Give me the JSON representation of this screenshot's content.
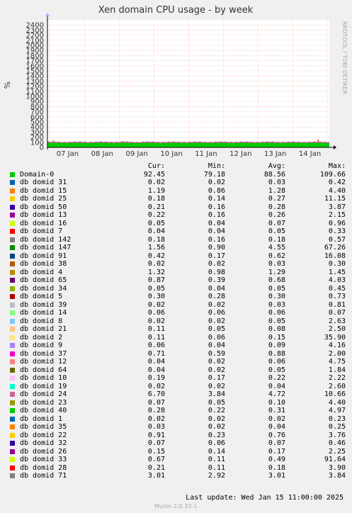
{
  "watermark": "RRDTOOL / TOBI OETIKER",
  "footer": {
    "last_update": "Last update:  Wed Jan 15 11:00:00 2025",
    "munin": "Munin 2.0.33-1"
  },
  "legend_header": {
    "cur": "Cur:",
    "min": "Min:",
    "avg": "Avg:",
    "max": "Max:"
  },
  "chart_data": {
    "type": "area",
    "title": "Xen domain CPU usage - by week",
    "ylabel": "%",
    "ylim": [
      0,
      2500
    ],
    "yticks": [
      0,
      100,
      200,
      300,
      400,
      500,
      600,
      700,
      800,
      900,
      1000,
      1100,
      1200,
      1300,
      1400,
      1500,
      1600,
      1700,
      1800,
      1900,
      2000,
      2100,
      2200,
      2300,
      2400
    ],
    "x_labels": [
      "07 Jan",
      "08 Jan",
      "09 Jan",
      "10 Jan",
      "11 Jan",
      "12 Jan",
      "13 Jan",
      "14 Jan"
    ],
    "grid": true,
    "series": [
      {
        "name": "Domain-0",
        "color": "#00cc00",
        "cur": "92.45",
        "min": "79.18",
        "avg": "88.56",
        "max": "109.66"
      },
      {
        "name": "db domid 31",
        "color": "#0066b3",
        "cur": "0.02",
        "min": "0.02",
        "avg": "0.03",
        "max": "0.42"
      },
      {
        "name": "db domid 15",
        "color": "#ff8000",
        "cur": "1.19",
        "min": "0.86",
        "avg": "1.28",
        "max": "4.40"
      },
      {
        "name": "db domid 25",
        "color": "#ffcc00",
        "cur": "0.18",
        "min": "0.14",
        "avg": "0.27",
        "max": "11.15"
      },
      {
        "name": "db domid 50",
        "color": "#330099",
        "cur": "0.21",
        "min": "0.16",
        "avg": "0.28",
        "max": "3.87"
      },
      {
        "name": "db domid 13",
        "color": "#990099",
        "cur": "0.22",
        "min": "0.16",
        "avg": "0.26",
        "max": "2.15"
      },
      {
        "name": "db domid 16",
        "color": "#ccff00",
        "cur": "0.05",
        "min": "0.04",
        "avg": "0.07",
        "max": "0.96"
      },
      {
        "name": "db domid 7",
        "color": "#ff0000",
        "cur": "0.04",
        "min": "0.04",
        "avg": "0.05",
        "max": "0.33"
      },
      {
        "name": "db domid 142",
        "color": "#808080",
        "cur": "0.18",
        "min": "0.16",
        "avg": "0.18",
        "max": "0.57"
      },
      {
        "name": "db domid 147",
        "color": "#008f00",
        "cur": "1.56",
        "min": "0.90",
        "avg": "4.55",
        "max": "67.26"
      },
      {
        "name": "db domid 91",
        "color": "#00487d",
        "cur": "0.42",
        "min": "0.17",
        "avg": "0.62",
        "max": "16.08"
      },
      {
        "name": "db domid 38",
        "color": "#b35a00",
        "cur": "0.02",
        "min": "0.02",
        "avg": "0.03",
        "max": "0.30"
      },
      {
        "name": "db domid 4",
        "color": "#b38f00",
        "cur": "1.32",
        "min": "0.98",
        "avg": "1.29",
        "max": "1.45"
      },
      {
        "name": "db domid 65",
        "color": "#6b006b",
        "cur": "0.87",
        "min": "0.39",
        "avg": "0.68",
        "max": "4.03"
      },
      {
        "name": "db domid 34",
        "color": "#8fb300",
        "cur": "0.05",
        "min": "0.04",
        "avg": "0.05",
        "max": "0.45"
      },
      {
        "name": "db domid 5",
        "color": "#b30000",
        "cur": "0.30",
        "min": "0.28",
        "avg": "0.30",
        "max": "0.73"
      },
      {
        "name": "db domid 39",
        "color": "#bebebe",
        "cur": "0.02",
        "min": "0.02",
        "avg": "0.03",
        "max": "0.81"
      },
      {
        "name": "db domid 14",
        "color": "#80ff80",
        "cur": "0.06",
        "min": "0.06",
        "avg": "0.06",
        "max": "0.07"
      },
      {
        "name": "db domid 8",
        "color": "#80c9ff",
        "cur": "0.02",
        "min": "0.02",
        "avg": "0.05",
        "max": "2.63"
      },
      {
        "name": "db domid 21",
        "color": "#ffc080",
        "cur": "0.11",
        "min": "0.05",
        "avg": "0.08",
        "max": "2.50"
      },
      {
        "name": "db domid 2",
        "color": "#ffe680",
        "cur": "0.11",
        "min": "0.06",
        "avg": "0.15",
        "max": "35.90"
      },
      {
        "name": "db domid 9",
        "color": "#aa80ff",
        "cur": "0.06",
        "min": "0.04",
        "avg": "0.09",
        "max": "4.16"
      },
      {
        "name": "db domid 37",
        "color": "#ee00cc",
        "cur": "0.71",
        "min": "0.59",
        "avg": "0.88",
        "max": "2.00"
      },
      {
        "name": "db domid 12",
        "color": "#ff8080",
        "cur": "0.04",
        "min": "0.02",
        "avg": "0.06",
        "max": "4.75"
      },
      {
        "name": "db domid 64",
        "color": "#666600",
        "cur": "0.04",
        "min": "0.02",
        "avg": "0.05",
        "max": "1.84"
      },
      {
        "name": "db domid 10",
        "color": "#ffbfff",
        "cur": "0.19",
        "min": "0.17",
        "avg": "0.22",
        "max": "2.22"
      },
      {
        "name": "db domid 19",
        "color": "#00ffcc",
        "cur": "0.02",
        "min": "0.02",
        "avg": "0.04",
        "max": "2.60"
      },
      {
        "name": "db domid 24",
        "color": "#cc6699",
        "cur": "6.70",
        "min": "3.84",
        "avg": "4.72",
        "max": "10.66"
      },
      {
        "name": "db domid 23",
        "color": "#999900",
        "cur": "0.07",
        "min": "0.05",
        "avg": "0.10",
        "max": "4.40"
      },
      {
        "name": "db domid 40",
        "color": "#00cc00",
        "cur": "0.28",
        "min": "0.22",
        "avg": "0.31",
        "max": "4.97"
      },
      {
        "name": "db domid 1",
        "color": "#0066b3",
        "cur": "0.02",
        "min": "0.02",
        "avg": "0.02",
        "max": "0.23"
      },
      {
        "name": "db domid 35",
        "color": "#ff8000",
        "cur": "0.03",
        "min": "0.02",
        "avg": "0.04",
        "max": "0.25"
      },
      {
        "name": "db domid 22",
        "color": "#ffcc00",
        "cur": "0.91",
        "min": "0.23",
        "avg": "0.76",
        "max": "3.76"
      },
      {
        "name": "db domid 32",
        "color": "#330099",
        "cur": "0.07",
        "min": "0.06",
        "avg": "0.07",
        "max": "0.46"
      },
      {
        "name": "db domid 26",
        "color": "#990099",
        "cur": "0.15",
        "min": "0.14",
        "avg": "0.17",
        "max": "2.25"
      },
      {
        "name": "db domid 33",
        "color": "#ccff00",
        "cur": "0.67",
        "min": "0.11",
        "avg": "0.49",
        "max": "91.64"
      },
      {
        "name": "db domid 28",
        "color": "#ff0000",
        "cur": "0.21",
        "min": "0.11",
        "avg": "0.18",
        "max": "3.90"
      },
      {
        "name": "db domid 71",
        "color": "#808080",
        "cur": "3.01",
        "min": "2.92",
        "avg": "3.01",
        "max": "3.84"
      }
    ]
  }
}
